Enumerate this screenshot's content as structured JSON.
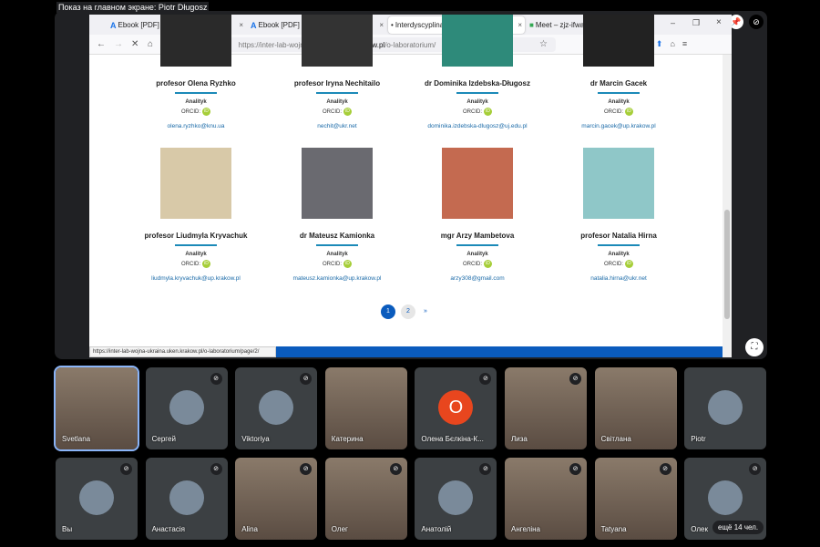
{
  "meet": {
    "presenting_label": "Показ на главном экране: Piotr Długosz",
    "more_label": "ещё 14 чел.",
    "pin_icon": "pin-icon",
    "mute_icon": "mic-off-icon"
  },
  "browser": {
    "tabs": [
      {
        "label": "Ebook [PDF] widok pliku Uchoo",
        "active": false
      },
      {
        "label": "Ebook [PDF] widok pliku Uchoo",
        "active": false
      },
      {
        "label": "Interdyscyplinarne Laboratorium",
        "active": true
      },
      {
        "label": "Meet – zjz-ifwa-wur",
        "active": false
      }
    ],
    "url_prefix": "https://inter-lab-wojna-ukraina.",
    "url_domain": "uken.krakow.pl",
    "url_path": "/o-laboratorium/",
    "status_url": "https://inter-lab-wojna-ukraina.uken.krakow.pl/o-laboratorium/page/2/"
  },
  "page": {
    "people": [
      {
        "name": "profesor Olena Ryzhko",
        "role": "Analityk",
        "orcid": "ORCID:",
        "email": "olena.ryzhko@knu.ua"
      },
      {
        "name": "profesor Iryna Nechitailo",
        "role": "Analityk",
        "orcid": "ORCID:",
        "email": "nechit@ukr.net"
      },
      {
        "name": "dr Dominika Izdebska-Długosz",
        "role": "Analityk",
        "orcid": "ORCID:",
        "email": "dominika.izdebska-dlugosz@uj.edu.pl"
      },
      {
        "name": "dr Marcin Gacek",
        "role": "Analityk",
        "orcid": "ORCID:",
        "email": "marcin.gacek@up.krakow.pl"
      },
      {
        "name": "profesor Liudmyla Kryvachuk",
        "role": "Analityk",
        "orcid": "ORCID:",
        "email": "liudmyla.kryvachuk@up.krakow.pl"
      },
      {
        "name": "dr Mateusz Kamionka",
        "role": "Analityk",
        "orcid": "ORCID:",
        "email": "mateusz.kamionka@up.krakow.pl"
      },
      {
        "name": "mgr Arzy Mambetova",
        "role": "Analityk",
        "orcid": "ORCID:",
        "email": "arzy308@gmail.com"
      },
      {
        "name": "profesor Natalia Hirna",
        "role": "Analityk",
        "orcid": "ORCID:",
        "email": "natalia.hirna@ukr.net"
      }
    ],
    "pagination": {
      "current": "1",
      "next_page": "2",
      "next": "»"
    }
  },
  "participants": [
    {
      "name": "Svetlana",
      "type": "video",
      "muted": false,
      "speaking": true
    },
    {
      "name": "Сергей",
      "type": "avatar",
      "muted": true
    },
    {
      "name": "Viktoriya",
      "type": "avatar",
      "muted": true
    },
    {
      "name": "Катерина",
      "type": "video",
      "muted": false
    },
    {
      "name": "Олена Бєлкіна-К...",
      "type": "letter",
      "letter": "O",
      "muted": true
    },
    {
      "name": "Лиза",
      "type": "video",
      "muted": true
    },
    {
      "name": "Світлана",
      "type": "video",
      "muted": false
    },
    {
      "name": "Piotr",
      "type": "avatar",
      "muted": false
    },
    {
      "name": "Вы",
      "type": "avatar",
      "muted": true
    },
    {
      "name": "Анастасія",
      "type": "avatar",
      "muted": true
    },
    {
      "name": "Alina",
      "type": "video",
      "muted": true
    },
    {
      "name": "Олег",
      "type": "video",
      "muted": true
    },
    {
      "name": "Анатолій",
      "type": "avatar",
      "muted": true
    },
    {
      "name": "Ангеліна",
      "type": "video",
      "muted": true
    },
    {
      "name": "Tatyana",
      "type": "video",
      "muted": true
    },
    {
      "name": "Олек",
      "type": "avatar",
      "muted": true
    }
  ]
}
